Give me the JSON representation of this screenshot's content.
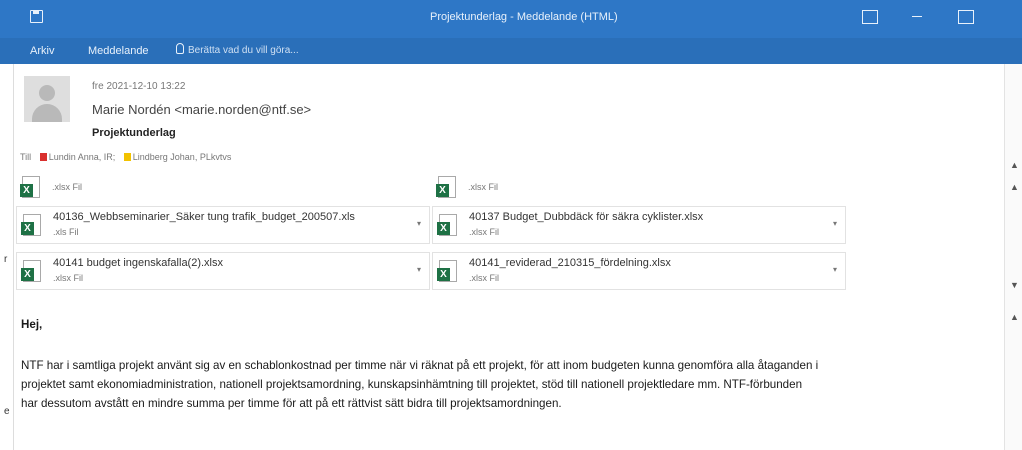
{
  "window": {
    "title": "Projektunderlag - Meddelande (HTML)",
    "ribbon_tabs": [
      "Arkiv",
      "Meddelande"
    ],
    "tell_me_placeholder": "Berätta vad du vill göra..."
  },
  "message": {
    "date": "fre 2021-12-10 13:22",
    "sender": "Marie Nordén <marie.norden@ntf.se>",
    "subject": "Projektunderlag",
    "to_label": "Till",
    "recipients": [
      {
        "name": "Lundin Anna, IR;",
        "color": "#d9302e"
      },
      {
        "name": "Lindberg Johan, PLkvtvs",
        "color": "#f2c200"
      }
    ]
  },
  "attachments": [
    {
      "name": "",
      "type": ".xlsx Fil"
    },
    {
      "name": "",
      "type": ".xlsx Fil"
    },
    {
      "name": "40136_Webbseminarier_Säker tung trafik_budget_200507.xls",
      "type": ".xls Fil"
    },
    {
      "name": "40137 Budget_Dubbdäck för säkra cyklister.xlsx",
      "type": ".xlsx Fil"
    },
    {
      "name": "40141 budget ingenskafalla(2).xlsx",
      "type": ".xlsx Fil"
    },
    {
      "name": "40141_reviderad_210315_fördelning.xlsx",
      "type": ".xlsx Fil"
    }
  ],
  "body": {
    "greeting": "Hej,",
    "lines": [
      "NTF har i samtliga projekt använt sig av en schablonkostnad per timme när vi räknat på ett projekt, för att inom budgeten kunna genomföra alla åtaganden i",
      "projektet samt ekonomiadministration, nationell projektsamordning, kunskapsinhämtning till projektet, stöd till nationell projektledare mm. NTF-förbunden",
      "har dessutom avstått en mindre summa per timme för att på ett rättvist sätt bidra till projektsamordningen."
    ]
  },
  "colors": {
    "titlebar": "#2e77c6",
    "ribbon": "#2a6fb9",
    "excel_green": "#1e7145"
  }
}
